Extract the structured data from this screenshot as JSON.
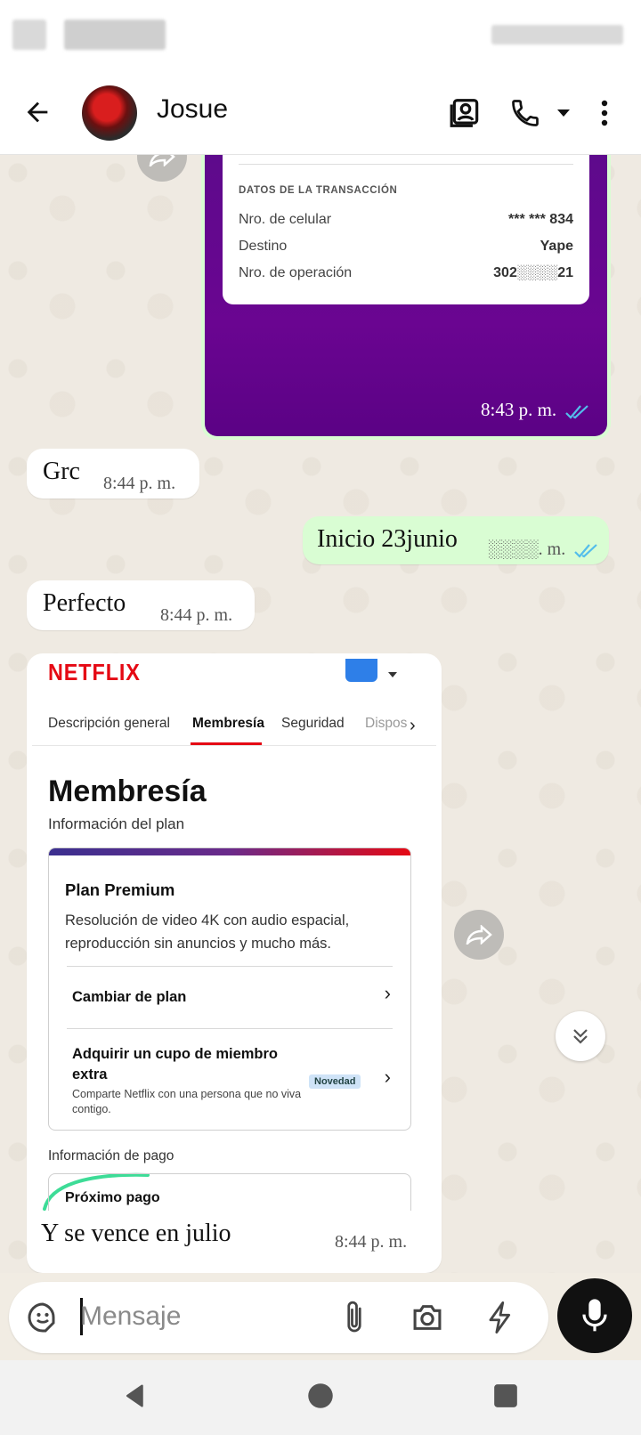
{
  "header": {
    "contact_name": "Josue"
  },
  "yape_receipt": {
    "section_title": "DATOS DE LA TRANSACCIÓN",
    "rows": [
      {
        "label": "Nro. de celular",
        "value": "*** *** 834"
      },
      {
        "label": "Destino",
        "value": "Yape"
      },
      {
        "label": "Nro. de operación",
        "value": "302░░░░21"
      }
    ],
    "time": "8:43 p. m."
  },
  "messages": [
    {
      "text": "Grc",
      "time": "8:44 p. m.",
      "direction": "in"
    },
    {
      "text": "Inicio 23junio",
      "time": "░░░░. m.",
      "direction": "out"
    },
    {
      "text": "Perfecto",
      "time": "8:44 p. m.",
      "direction": "in"
    }
  ],
  "netflix": {
    "logo": "NETFLIX",
    "tabs": [
      "Descripción general",
      "Membresía",
      "Seguridad",
      "Dispos"
    ],
    "active_tab": "Membresía",
    "title": "Membresía",
    "subtitle": "Información del plan",
    "plan_name": "Plan Premium",
    "plan_desc": "Resolución de video 4K con audio espacial, reproducción sin anuncios y mucho más.",
    "row1_label": "Cambiar de plan",
    "row2_label": "Adquirir un cupo de miembro extra",
    "row2_small": "Comparte Netflix con una persona que no viva contigo.",
    "badge": "Novedad",
    "pay_section": "Información de pago",
    "next_payment": "Próximo pago",
    "caption": "Y se vence en julio",
    "time": "8:44 p. m."
  },
  "input": {
    "placeholder": "Mensaje"
  },
  "colors": {
    "outgoing_bubble": "#d9fdd3",
    "incoming_bubble": "#ffffff",
    "read_ticks": "#53bdeb",
    "netflix_red": "#e50914",
    "yape_purple": "#6a0591"
  }
}
